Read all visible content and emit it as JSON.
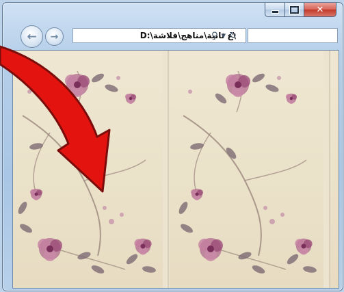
{
  "window": {
    "address_path": "D:\\ع ثانية\\مناهج\\فلاشة\\",
    "minimize_icon": "minimize-icon",
    "maximize_icon": "maximize-icon",
    "close_icon": "close-icon",
    "close_glyph": "✕"
  },
  "nav": {
    "back_icon": "back-arrow-icon",
    "forward_icon": "forward-arrow-icon",
    "back_glyph": "←",
    "forward_glyph": "→",
    "search_icon": "search-icon",
    "dropdown_icon": "dropdown-icon",
    "refresh_icon": "refresh-icon",
    "search_glyph": "⚲",
    "dropdown_glyph": "▾",
    "refresh_glyph": "↻"
  },
  "content": {
    "description_colors": {
      "background": "#ece4cf",
      "flower": "#a8557f",
      "leaf": "#7e6b73",
      "arrow": "#e01010"
    }
  }
}
